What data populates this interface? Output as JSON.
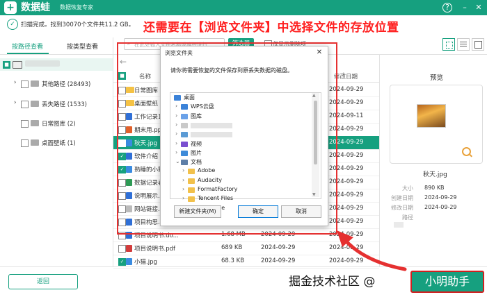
{
  "app": {
    "logo_char": "+",
    "name": "数据蛙",
    "subtitle": "数据恢复专家",
    "help_icon": "?",
    "min_icon": "–",
    "close_icon": "✕"
  },
  "status": {
    "text": "扫描完成。找到30070个文件共11.2 GB。",
    "check_icon": "✓"
  },
  "annotation": {
    "text": "还需要在【浏览文件夹】中选择文件的存放位置"
  },
  "left_panel": {
    "tabs": [
      {
        "label": "按路径查看"
      },
      {
        "label": "按类型查看"
      }
    ],
    "root_label": "",
    "tree": [
      {
        "label": "其他路径 (28493)"
      },
      {
        "label": "丢失路径 (1533)"
      },
      {
        "label": "日常图库 (2)"
      },
      {
        "label": "桌面壁纸 (1)"
      }
    ]
  },
  "toolbar": {
    "search_placeholder": "在此处输入文件名称或路径进行",
    "filter_label": "筛选器",
    "only_deleted_label": "仅显示删除项"
  },
  "list": {
    "header_name": "名称",
    "header_date": "修改日期",
    "rows": [
      {
        "name": "日常图库",
        "size": "",
        "date": "2024-09-29",
        "icon": "folder",
        "checked": false
      },
      {
        "name": "桌面壁纸",
        "size": "",
        "date": "2024-09-29",
        "icon": "folder",
        "checked": false
      },
      {
        "name": "工作记录1",
        "size": "",
        "date": "2024-09-11",
        "icon": "doc",
        "checked": false
      },
      {
        "name": "期末用.ppt",
        "size": "",
        "date": "2024-09-29",
        "icon": "ppt",
        "checked": false
      },
      {
        "name": "秋天.jpg",
        "size": "",
        "date": "2024-09-29",
        "icon": "img",
        "checked": true
      },
      {
        "name": "软件介绍",
        "size": "",
        "date": "2024-09-29",
        "icon": "doc",
        "checked": true
      },
      {
        "name": "熟睡的小猫",
        "size": "",
        "date": "2024-09-29",
        "icon": "img",
        "checked": true
      },
      {
        "name": "数据记录表",
        "size": "",
        "date": "2024-09-29",
        "icon": "xls",
        "checked": false
      },
      {
        "name": "说明展示.p",
        "size": "",
        "date": "2024-09-29",
        "icon": "doc",
        "checked": false
      },
      {
        "name": "网站链接.t",
        "size": "",
        "date": "2024-09-29",
        "icon": "txt",
        "checked": false
      },
      {
        "name": "项目构思.docx",
        "size": "1.0 MB",
        "date": "2024-09-29",
        "icon": "doc",
        "checked": false
      },
      {
        "name": "项目说明书.do...",
        "size": "1.68 MB",
        "date": "2024-09-29",
        "icon": "doc",
        "checked": false
      },
      {
        "name": "项目说明书.pdf",
        "size": "689 KB",
        "date": "2024-09-29",
        "icon": "pdf",
        "checked": false
      },
      {
        "name": "小猫.jpg",
        "size": "68.3 KB",
        "date": "2024-09-29",
        "icon": "img",
        "checked": true
      }
    ]
  },
  "preview": {
    "title": "预览",
    "filename": "秋天.jpg",
    "meta": [
      {
        "key": "大小",
        "value": "890 KB"
      },
      {
        "key": "创建日期",
        "value": "2024-09-29"
      },
      {
        "key": "修改日期",
        "value": "2024-09-29"
      },
      {
        "key": "路径",
        "value": ""
      }
    ]
  },
  "dialog": {
    "title": "浏览文件夹",
    "prompt": "请你将需要恢复的文件保存到原丢失数据的磁盘。",
    "tree": [
      {
        "label": "桌面",
        "level": 0,
        "icon": "desktop"
      },
      {
        "label": "WPS云盘",
        "level": 1,
        "icon": "cloud"
      },
      {
        "label": "图库",
        "level": 1,
        "icon": "lib"
      },
      {
        "label": "",
        "level": 1,
        "icon": "user"
      },
      {
        "label": "",
        "level": 1,
        "icon": "pc"
      },
      {
        "label": "视频",
        "level": 1,
        "icon": "video"
      },
      {
        "label": "图片",
        "level": 1,
        "icon": "pic"
      },
      {
        "label": "文档",
        "level": 1,
        "icon": "docs"
      },
      {
        "label": "Adobe",
        "level": 2,
        "icon": "folder"
      },
      {
        "label": "Audacity",
        "level": 2,
        "icon": "folder"
      },
      {
        "label": "FormatFactory",
        "level": 2,
        "icon": "folder"
      },
      {
        "label": "Tencent Files",
        "level": 2,
        "icon": "folder"
      },
      {
        "label": "WPSDrive",
        "level": 2,
        "icon": "folder"
      }
    ],
    "new_folder_label": "新建文件夹(M)",
    "ok_label": "确定",
    "cancel_label": "取消"
  },
  "bottom": {
    "back_label": "返回",
    "recover_label": "小明助手",
    "watermark": "掘金技术社区 @"
  },
  "colors": {
    "accent": "#16a07f",
    "annotation": "#ff2020"
  }
}
